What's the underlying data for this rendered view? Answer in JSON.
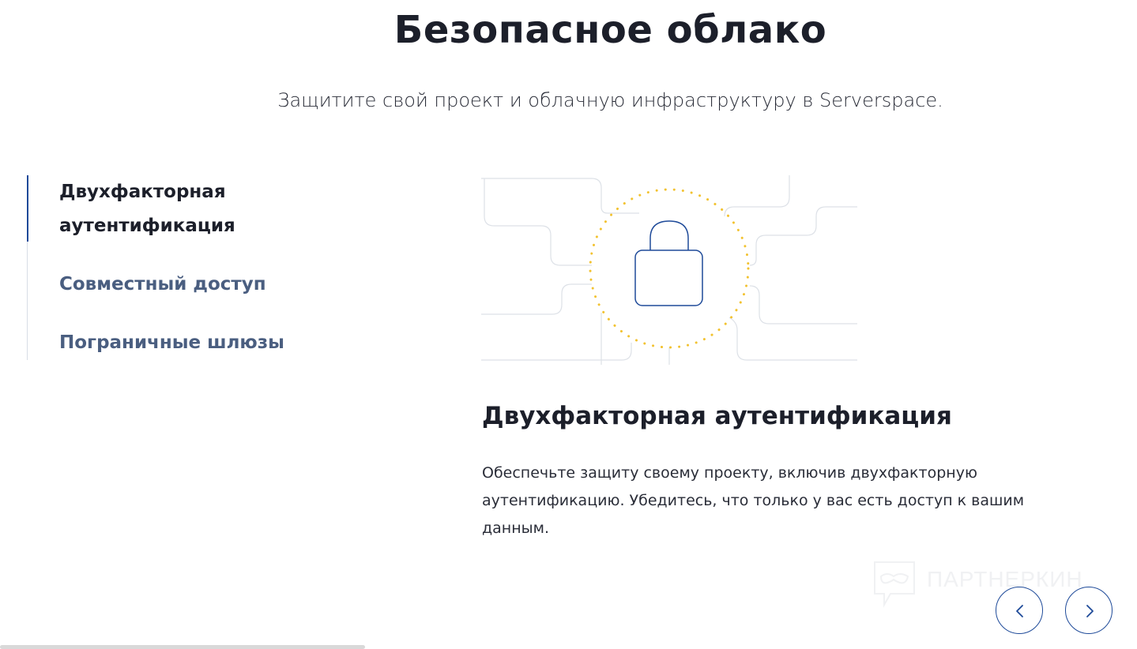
{
  "header": {
    "title": "Безопасное облако",
    "subtitle": "Защитите свой проект и облачную инфраструктуру в Serverspace."
  },
  "tabs": [
    {
      "label": "Двухфакторная аутентификация",
      "active": true
    },
    {
      "label": "Совместный доступ",
      "active": false
    },
    {
      "label": "Пограничные шлюзы",
      "active": false
    }
  ],
  "content": {
    "title": "Двухфакторная аутентификация",
    "text": "Обеспечьте защиту своему проекту, включив двухфакторную аутентификацию. Убедитесь, что только у вас есть доступ к вашим данным.",
    "illustration_icon": "lock-icon"
  },
  "watermark": {
    "text": "ПАРТНЕРКИН"
  },
  "navigation": {
    "prev_icon": "chevron-left-icon",
    "next_icon": "chevron-right-icon"
  },
  "colors": {
    "accent": "#1e4a99",
    "text": "#1c1f2a",
    "tab_inactive": "#4a5e80",
    "dots": "#f2c230"
  }
}
